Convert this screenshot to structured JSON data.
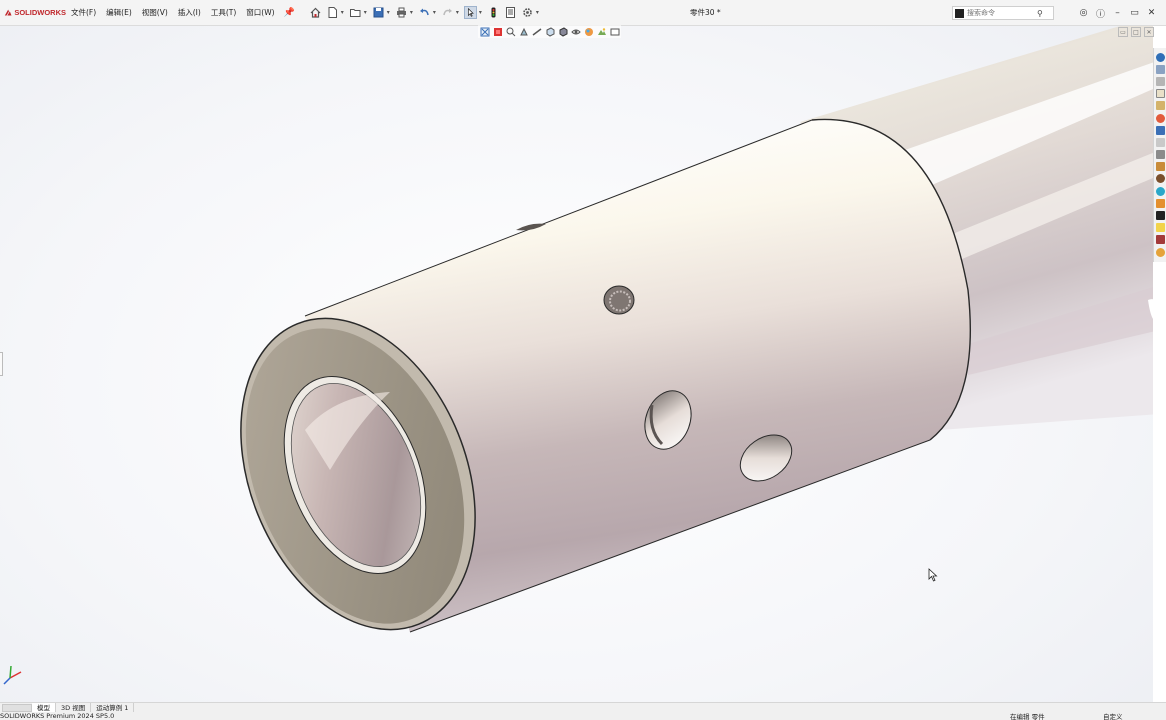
{
  "app": {
    "logo_text": "SOLIDWORKS",
    "document_title": "零件30 *"
  },
  "menu": {
    "items": [
      "文件(F)",
      "编辑(E)",
      "视图(V)",
      "插入(I)",
      "工具(T)",
      "窗口(W)"
    ],
    "pin_icon": "pushpin-icon"
  },
  "search": {
    "placeholder": "搜索命令"
  },
  "tabs": {
    "items": [
      "模型",
      "3D 视图",
      "运动算例 1"
    ],
    "active": 0
  },
  "status": {
    "product": "SOLIDWORKS Premium 2024 SP5.0",
    "editing": "在编辑 零件",
    "units": "自定义"
  },
  "colors": {
    "brand": "#c0282d",
    "toolbar_bg": "#f4f4f4",
    "part_body": "#eee7e3",
    "part_end_face": "#a89f92",
    "part_edge": "#2a2a2a"
  },
  "icons": {
    "toolbar": [
      "home-icon",
      "new-document-icon",
      "open-folder-icon",
      "save-icon",
      "print-icon",
      "undo-icon",
      "redo-icon",
      "select-arrow-icon",
      "rebuild-traffic-light-icon",
      "file-properties-icon",
      "options-gear-icon"
    ],
    "window": [
      "user-account-icon",
      "help-icon",
      "minimize-icon",
      "restore-icon",
      "close-icon"
    ],
    "task_pane": [
      "solidworks-resources-icon",
      "design-library-icon",
      "file-explorer-icon",
      "view-palette-icon",
      "appearances-icon",
      "custom-properties-icon",
      "toolbox-icon",
      "3dexperience-icon"
    ]
  }
}
